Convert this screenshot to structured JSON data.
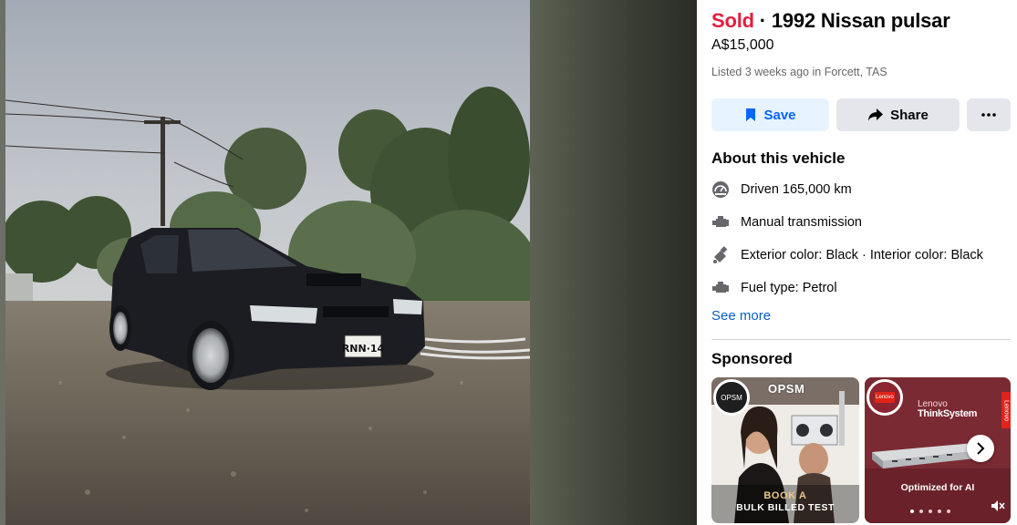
{
  "listing": {
    "status": "Sold",
    "separator": " · ",
    "title": "1992 Nissan pulsar",
    "price": "A$15,000",
    "listed": "Listed 3 weeks ago in Forcett, TAS"
  },
  "actions": {
    "save_label": "Save",
    "share_label": "Share",
    "more_label": "More options"
  },
  "about": {
    "heading": "About this vehicle",
    "specs": [
      {
        "icon": "speedometer-icon",
        "text": "Driven 165,000 km"
      },
      {
        "icon": "engine-icon",
        "text": "Manual transmission"
      },
      {
        "icon": "paint-icon",
        "text": "Exterior color: Black · Interior color: Black"
      },
      {
        "icon": "fuel-engine-icon",
        "text": "Fuel type: Petrol"
      }
    ],
    "see_more": "See more"
  },
  "sponsored": {
    "heading": "Sponsored",
    "ads": [
      {
        "logo_text": "OPSM",
        "brand": "OPSM",
        "cta_line1": "BOOK A",
        "cta_line2": "BULK BILLED TEST"
      },
      {
        "logo_text": "Lenovo",
        "brand_line1": "Lenovo",
        "brand_line2": "ThinkSystem",
        "vendor": "Lenovo",
        "caption": "Optimized for AI",
        "active_dot": 0,
        "dots": 5
      }
    ]
  },
  "plate": "RNN·14",
  "colors": {
    "sold": "#e41e3f",
    "link": "#0a5ec4",
    "save_bg": "#e7f3ff",
    "save_fg": "#0866ff",
    "button_bg": "#e4e6eb"
  }
}
